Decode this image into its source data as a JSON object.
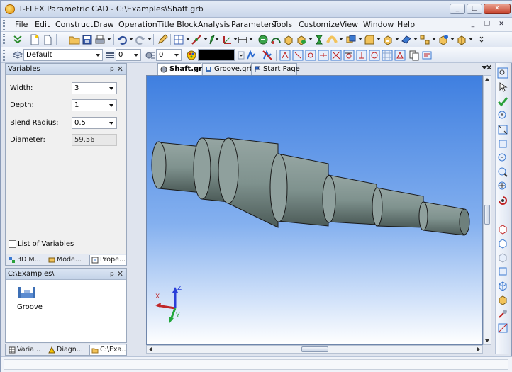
{
  "window": {
    "title": "T-FLEX Parametric CAD - C:\\Examples\\Shaft.grb",
    "controls": {
      "minimize": "_",
      "maximize": "□",
      "close": "✕"
    }
  },
  "menu": {
    "items": [
      "File",
      "Edit",
      "Construct",
      "Draw",
      "Operation",
      "Title Block",
      "Analysis",
      "Parameters",
      "Tools",
      "Customize",
      "View",
      "Window",
      "Help"
    ],
    "mdi_controls": {
      "minimize": "_",
      "restore": "❐",
      "close": "✕"
    }
  },
  "toolbar2": {
    "layer_combo": "Default",
    "level_value_1": "0",
    "level_value_2": "0"
  },
  "variables_panel": {
    "title": "Variables",
    "rows": [
      {
        "label": "Width:",
        "value": "3"
      },
      {
        "label": "Depth:",
        "value": "1"
      },
      {
        "label": "Blend Radius:",
        "value": "0.5"
      }
    ],
    "readonly_row": {
      "label": "Diameter:",
      "value": "59.56"
    },
    "list_checkbox_label": "List of Variables",
    "list_checkbox_checked": false
  },
  "dock_tabs_top": [
    "3D M...",
    "Mode...",
    "Prope..."
  ],
  "explorer_panel": {
    "title": "C:\\Examples\\",
    "items": [
      {
        "label": "Groove",
        "icon": "groove-file-icon"
      }
    ]
  },
  "dock_tabs_bottom": [
    "Varia...",
    "Diagn...",
    "C:\\Exa..."
  ],
  "document_tabs": [
    {
      "label": "Shaft.grb",
      "active": true
    },
    {
      "label": "Groove.grb",
      "active": false
    },
    {
      "label": "Start Page",
      "active": false
    }
  ],
  "viewport": {
    "axis_labels": {
      "x": "X",
      "y": "Y",
      "z": "Z"
    },
    "colors": {
      "bg_top": "#3f7fe0",
      "bg_bottom": "#ffffff",
      "shaft": "#7f928e",
      "axis_x": "#c0282a",
      "axis_y": "#22a83a",
      "axis_z": "#2a3fd8"
    }
  },
  "status": {
    "text": ""
  }
}
